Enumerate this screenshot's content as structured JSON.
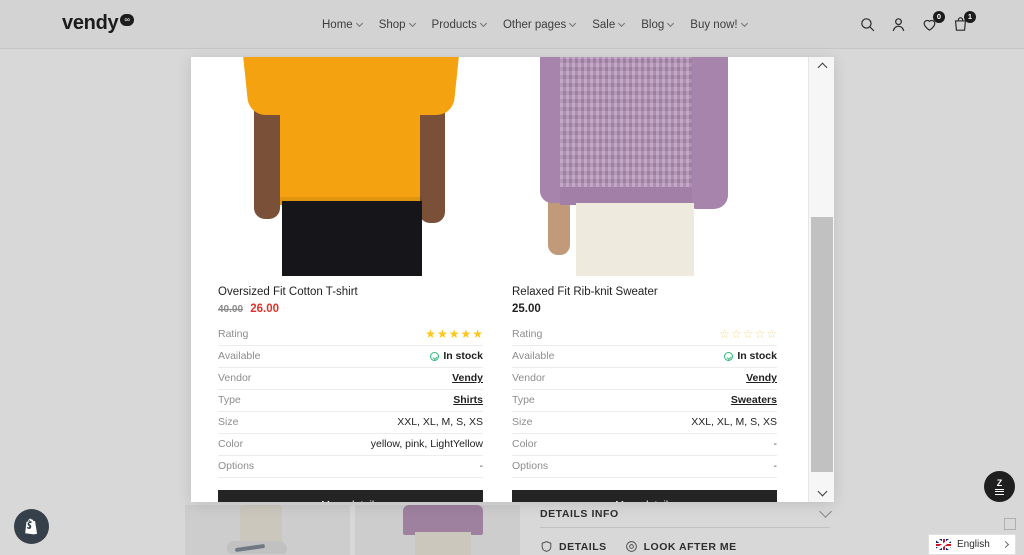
{
  "header": {
    "logo_text": "vendy",
    "logo_badge": "∞",
    "nav": [
      {
        "label": "Home",
        "has_caret": true
      },
      {
        "label": "Shop",
        "has_caret": true
      },
      {
        "label": "Products",
        "has_caret": true
      },
      {
        "label": "Other pages",
        "has_caret": true
      },
      {
        "label": "Sale",
        "has_caret": true
      },
      {
        "label": "Blog",
        "has_caret": true
      },
      {
        "label": "Buy now!",
        "has_caret": true
      }
    ],
    "icons": {
      "search": "search-icon",
      "account": "user-icon",
      "wishlist": "heart-icon",
      "wishlist_count": "0",
      "cart": "cart-icon",
      "cart_count": "1"
    }
  },
  "modal": {
    "labels": {
      "rating": "Rating",
      "available": "Available",
      "vendor": "Vendor",
      "type": "Type",
      "size": "Size",
      "color": "Color",
      "options": "Options"
    },
    "more_details_label": "More details",
    "products": [
      {
        "title": "Oversized Fit Cotton T-shirt",
        "price_old": "40.00",
        "price": "26.00",
        "on_sale": true,
        "rating": 5,
        "available": "In stock",
        "vendor": "Vendy",
        "type": "Shirts",
        "size": "XXL, XL, M, S, XS",
        "color": "yellow, pink, LightYellow",
        "options": "-"
      },
      {
        "title": "Relaxed Fit Rib-knit Sweater",
        "price_old": "",
        "price": "25.00",
        "on_sale": false,
        "rating": 0,
        "available": "In stock",
        "vendor": "Vendy",
        "type": "Sweaters",
        "size": "XXL, XL, M, S, XS",
        "color": "-",
        "options": "-"
      }
    ]
  },
  "background": {
    "details_info_label": "DETAILS INFO",
    "tabs": [
      {
        "label": "DETAILS",
        "icon": "shield-icon"
      },
      {
        "label": "LOOK AFTER ME",
        "icon": "circle-target-icon"
      }
    ]
  },
  "floating": {
    "shopify_badge": "shopify-bag-icon",
    "fab_label": "Z",
    "language": "English"
  },
  "colors": {
    "accent_sale": "#e0322a",
    "star": "#ffc61a",
    "stock": "#2fb87a",
    "button": "#242424",
    "header_bg": "#d3d3d3"
  }
}
